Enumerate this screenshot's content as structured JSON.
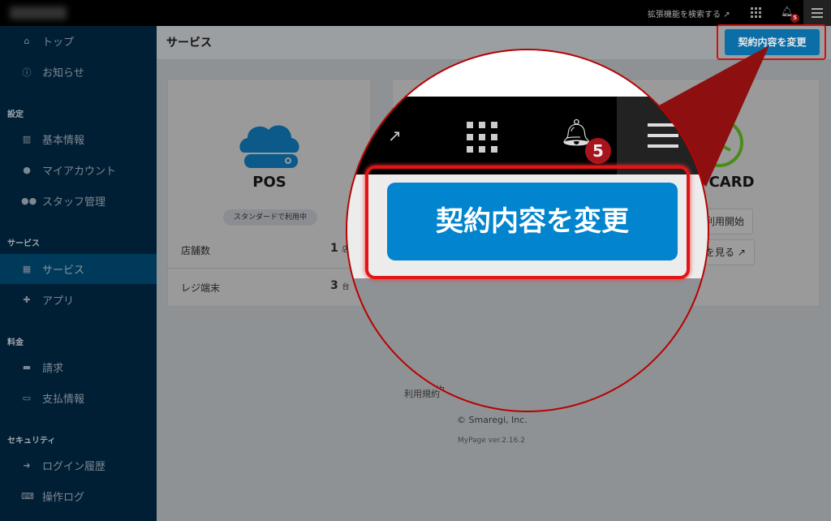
{
  "topbar": {
    "extension_search": "拡張機能を検索する",
    "notification_count": "5",
    "icons": [
      "external-link-icon",
      "grid-icon",
      "bell-icon",
      "hamburger-menu-icon"
    ]
  },
  "sidebar": {
    "items_top": [
      {
        "label": "トップ",
        "icon": "home-icon"
      },
      {
        "label": "お知らせ",
        "icon": "info-icon"
      }
    ],
    "sections": [
      {
        "title": "設定",
        "items": [
          {
            "label": "基本情報",
            "icon": "building-icon"
          },
          {
            "label": "マイアカウント",
            "icon": "user-icon"
          },
          {
            "label": "スタッフ管理",
            "icon": "users-icon"
          }
        ]
      },
      {
        "title": "サービス",
        "items": [
          {
            "label": "サービス",
            "icon": "grid-icon",
            "active": true
          },
          {
            "label": "アプリ",
            "icon": "puzzle-icon"
          }
        ]
      },
      {
        "title": "料金",
        "items": [
          {
            "label": "請求",
            "icon": "money-icon"
          },
          {
            "label": "支払情報",
            "icon": "credit-card-icon"
          }
        ]
      },
      {
        "title": "セキュリティ",
        "items": [
          {
            "label": "ログイン履歴",
            "icon": "sign-in-icon"
          },
          {
            "label": "操作ログ",
            "icon": "keyboard-icon"
          }
        ]
      }
    ]
  },
  "main": {
    "title": "サービス",
    "change_contract_button": "契約内容を変更",
    "pos_card": {
      "name": "POS",
      "status": "スタンダードで利用中",
      "rows": [
        {
          "label": "店舗数",
          "value": "1",
          "unit": "店"
        },
        {
          "label": "レジ端末",
          "value": "3",
          "unit": "台"
        }
      ]
    },
    "timecard_card": {
      "name": "E CARD",
      "start_button": "利用開始",
      "details_button": "を見る"
    }
  },
  "footer": {
    "terms": "利用規約",
    "copyright": "© Smaregi, Inc.",
    "version": "MyPage ver.2.16.2"
  },
  "colors": {
    "accent": "#0284cf",
    "highlight": "#e01515",
    "sidebar": "#001f35",
    "pos_icon": "#0b5a8a",
    "clock_icon": "#4a8c1a"
  }
}
